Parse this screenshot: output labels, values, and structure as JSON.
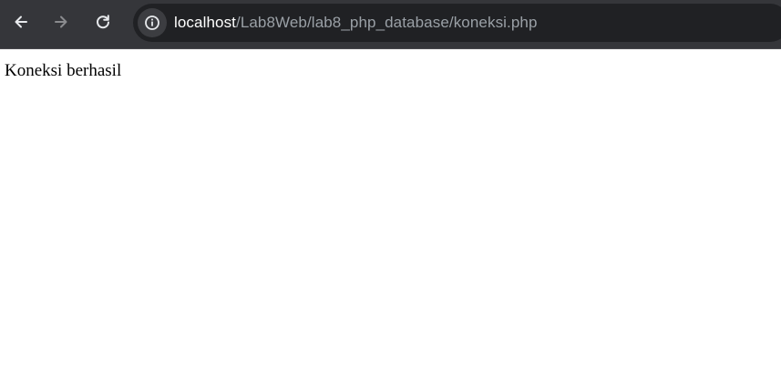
{
  "toolbar": {
    "back_icon": "arrow-left-icon",
    "forward_icon": "arrow-right-icon",
    "reload_icon": "reload-icon",
    "info_icon": "info-icon",
    "colors": {
      "toolbar_bg": "#35363a",
      "omnibox_bg": "#202124",
      "host_text": "#ffffff",
      "path_text": "#9aa0a6"
    }
  },
  "address_bar": {
    "host": "localhost",
    "path": "/Lab8Web/lab8_php_database/koneksi.php"
  },
  "page": {
    "message": "Koneksi berhasil"
  }
}
